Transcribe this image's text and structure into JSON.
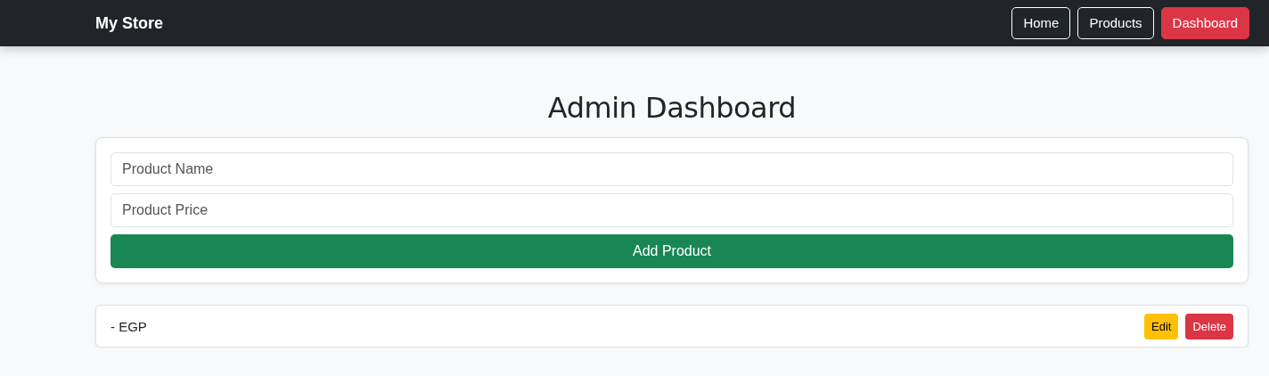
{
  "navbar": {
    "brand": "My Store",
    "links": [
      {
        "label": "Home",
        "selected": false
      },
      {
        "label": "Products",
        "selected": false
      },
      {
        "label": "Dashboard",
        "selected": true
      }
    ]
  },
  "page": {
    "title": "Admin Dashboard"
  },
  "form": {
    "fields": [
      {
        "placeholder": "Product Name"
      },
      {
        "placeholder": "Product Price"
      }
    ],
    "submit": "Add Product"
  },
  "products": [
    {
      "text": "- EGP",
      "actions": [
        {
          "label": "Edit",
          "kind": "edit"
        },
        {
          "label": "Delete",
          "kind": "delete"
        }
      ]
    }
  ]
}
